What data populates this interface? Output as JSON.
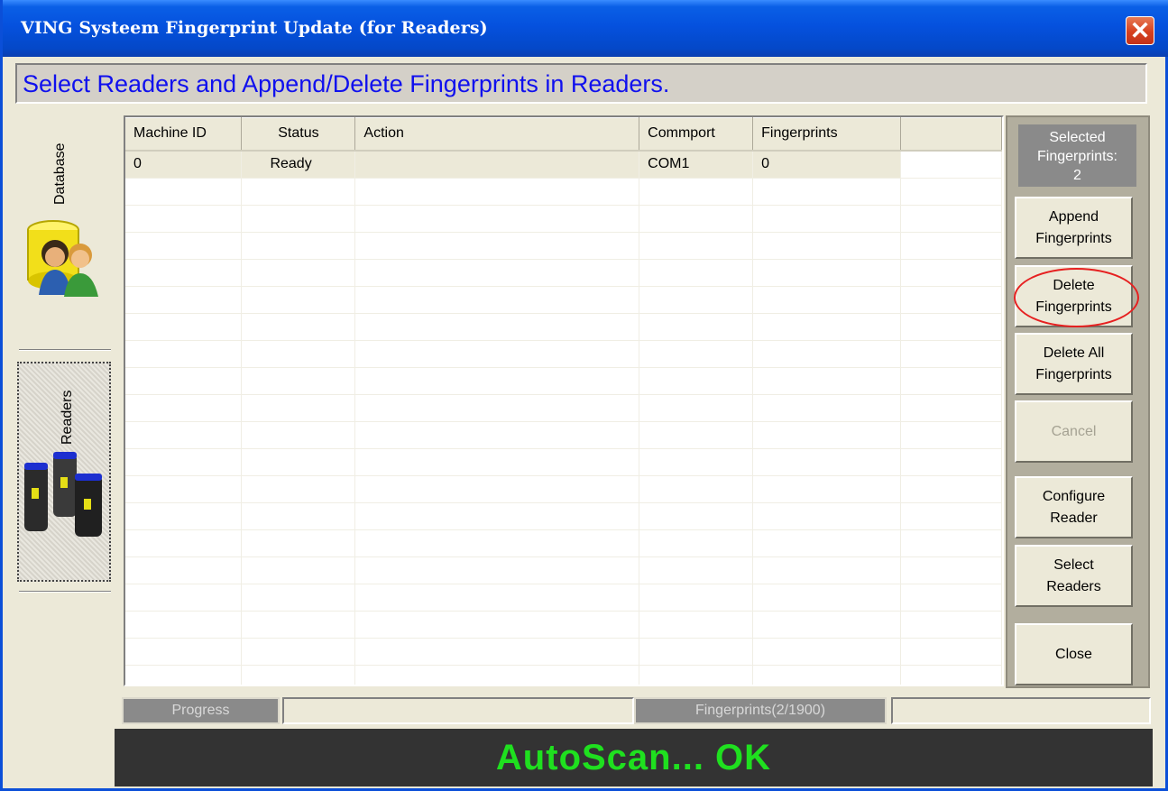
{
  "window": {
    "title": "VING Systeem Fingerprint Update (for Readers)",
    "close_symbol": "✕"
  },
  "header": {
    "text": "Select Readers and Append/Delete Fingerprints in Readers."
  },
  "left_tabs": [
    {
      "label": "Database",
      "icon": "database-users-icon"
    },
    {
      "label": "Readers",
      "icon": "fingerprint-readers-icon"
    }
  ],
  "grid": {
    "columns": [
      "Machine ID",
      "Status",
      "Action",
      "Commport",
      "Fingerprints"
    ],
    "rows": [
      {
        "machine_id": "0",
        "status": "Ready",
        "action": "",
        "commport": "COM1",
        "fingerprints": "0"
      }
    ]
  },
  "sidebar": {
    "selected_label": "Selected\nFingerprints:",
    "selected_count": "2",
    "buttons": {
      "append": "Append\nFingerprints",
      "delete": "Delete\nFingerprints",
      "delete_all": "Delete All\nFingerprints",
      "cancel": "Cancel",
      "configure": "Configure\nReader",
      "select_readers": "Select\nReaders",
      "close": "Close"
    }
  },
  "status": {
    "progress_label": "Progress",
    "fingerprints_label": "Fingerprints(2/1900)",
    "message": "AutoScan... OK"
  },
  "colors": {
    "titlebar": "#0551de",
    "header_text": "#1010ee",
    "status_text": "#1fe01f",
    "status_bg": "#333333",
    "highlight": "#e62020"
  }
}
